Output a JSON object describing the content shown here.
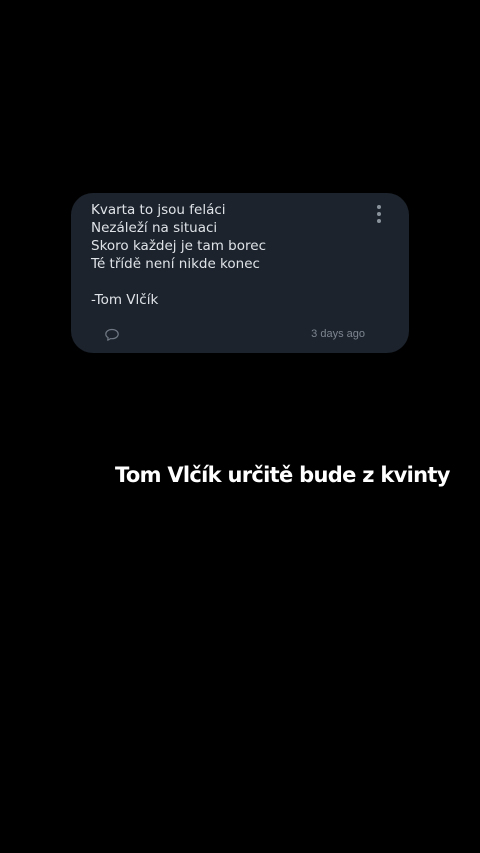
{
  "note": {
    "text": "Kvarta to jsou feláci\nNezáleží na situaci\nSkoro každej je tam borec\nTé třídě není nikde konec\n\n-Tom Vlčík",
    "timestamp": "3 days ago",
    "more_icon": "more-vertical-icon",
    "comment_icon": "comment-icon"
  },
  "overlay": {
    "caption": "Tom Vlčík určitě bude z kvinty"
  },
  "colors": {
    "background": "#000000",
    "card": "#1c232c",
    "note_text": "#dfe3e8",
    "muted": "#7d8591"
  }
}
